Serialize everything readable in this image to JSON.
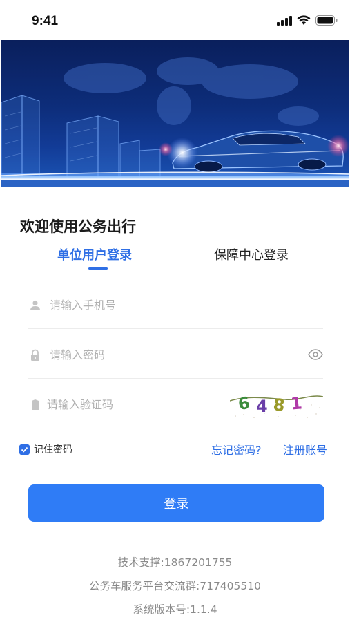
{
  "status_bar": {
    "time": "9:41"
  },
  "welcome_title": "欢迎使用公务出行",
  "tabs": [
    {
      "label": "单位用户登录",
      "active": true
    },
    {
      "label": "保障中心登录",
      "active": false
    }
  ],
  "form": {
    "phone_placeholder": "请输入手机号",
    "password_placeholder": "请输入密码",
    "captcha_placeholder": "请输入验证码",
    "captcha_code": "6481"
  },
  "options": {
    "remember_label": "记住密码",
    "remember_checked": true,
    "forgot_label": "忘记密码?",
    "register_label": "注册账号"
  },
  "login_button": "登录",
  "footer": {
    "support": "技术支撑:1867201755",
    "group": "公务车服务平台交流群:717405510",
    "version": "系统版本号:1.1.4"
  },
  "colors": {
    "accent": "#2f6fe5",
    "button": "#2f7cf6"
  }
}
